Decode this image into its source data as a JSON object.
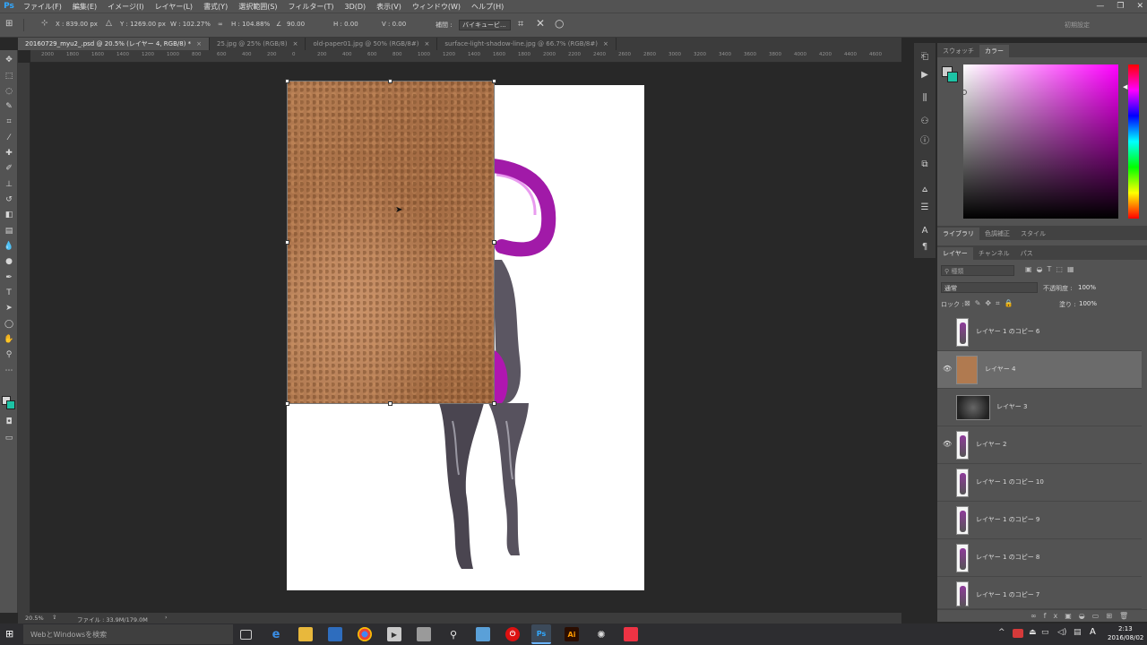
{
  "app": {
    "logo": "Ps"
  },
  "menubar": {
    "items": [
      "ファイル(F)",
      "編集(E)",
      "イメージ(I)",
      "レイヤー(L)",
      "書式(Y)",
      "選択範囲(S)",
      "フィルター(T)",
      "3D(D)",
      "表示(V)",
      "ウィンドウ(W)",
      "ヘルプ(H)"
    ],
    "window_controls": [
      "—",
      "❐",
      "✕"
    ]
  },
  "optionsbar": {
    "x": "X : 839.00 px",
    "y": "Y : 1269.00 px",
    "w": "W : 102.27%",
    "h": "H : 104.88%",
    "angle": "90.00",
    "hskew": "H : 0.00",
    "vskew": "V : 0.00",
    "interp_label": "補間 :",
    "interp_value": "バイキュービ...",
    "workspace": "初期設定"
  },
  "tabs": [
    {
      "label": "20160729_myu2_.psd @ 20.5% (レイヤー 4, RGB/8) *",
      "active": true
    },
    {
      "label": "25.jpg @ 25% (RGB/8)",
      "active": false
    },
    {
      "label": "old-paper01.jpg @ 50% (RGB/8#)",
      "active": false
    },
    {
      "label": "surface-light-shadow-line.jpg @ 66.7% (RGB/8#)",
      "active": false
    }
  ],
  "ruler": {
    "ticks": [
      "2000",
      "1800",
      "1600",
      "1400",
      "1200",
      "1000",
      "800",
      "600",
      "400",
      "200",
      "0",
      "200",
      "400",
      "600",
      "800",
      "1000",
      "1200",
      "1400",
      "1600",
      "1800",
      "2000",
      "2200",
      "2400",
      "2600",
      "2800",
      "3000",
      "3200",
      "3400",
      "3600",
      "3800",
      "4000",
      "4200",
      "4400",
      "4600"
    ]
  },
  "right_panel": {
    "top_tabs": [
      "スウォッチ",
      "カラー"
    ],
    "mid_tabs": [
      "ライブラリ",
      "色調補正",
      "スタイル"
    ],
    "layer_tabs": [
      "レイヤー",
      "チャンネル",
      "パス"
    ],
    "filter_placeholder": "種類",
    "blend_mode": "通常",
    "opacity_label": "不透明度 :",
    "opacity_value": "100%",
    "lock_label": "ロック :",
    "fill_label": "塗り :",
    "fill_value": "100%"
  },
  "layers": [
    {
      "name": "レイヤー 1 のコピー 6",
      "visible": false,
      "selected": false,
      "thumb": "figure"
    },
    {
      "name": "レイヤー 4",
      "visible": true,
      "selected": true,
      "thumb": "texture"
    },
    {
      "name": "レイヤー 3",
      "visible": false,
      "selected": false,
      "thumb": "dark"
    },
    {
      "name": "レイヤー 2",
      "visible": true,
      "selected": false,
      "thumb": "figure"
    },
    {
      "name": "レイヤー 1 のコピー 10",
      "visible": false,
      "selected": false,
      "thumb": "figure"
    },
    {
      "name": "レイヤー 1 のコピー 9",
      "visible": false,
      "selected": false,
      "thumb": "figure"
    },
    {
      "name": "レイヤー 1 のコピー 8",
      "visible": false,
      "selected": false,
      "thumb": "figure"
    },
    {
      "name": "レイヤー 1 のコピー 7",
      "visible": false,
      "selected": false,
      "thumb": "figure"
    }
  ],
  "status": {
    "zoom": "20.5%",
    "file_info": "ファイル : 33.9M/179.0M"
  },
  "taskbar": {
    "search_placeholder": "WebとWindowsを検索",
    "ime": "A",
    "time": "2:13",
    "date": "2016/08/02"
  },
  "colors": {
    "accent": "#31a8ff",
    "panel": "#535353",
    "canvas_bg": "#282828",
    "fg_swatch": "#cfcfcf",
    "bg_swatch": "#1dc3a5"
  }
}
